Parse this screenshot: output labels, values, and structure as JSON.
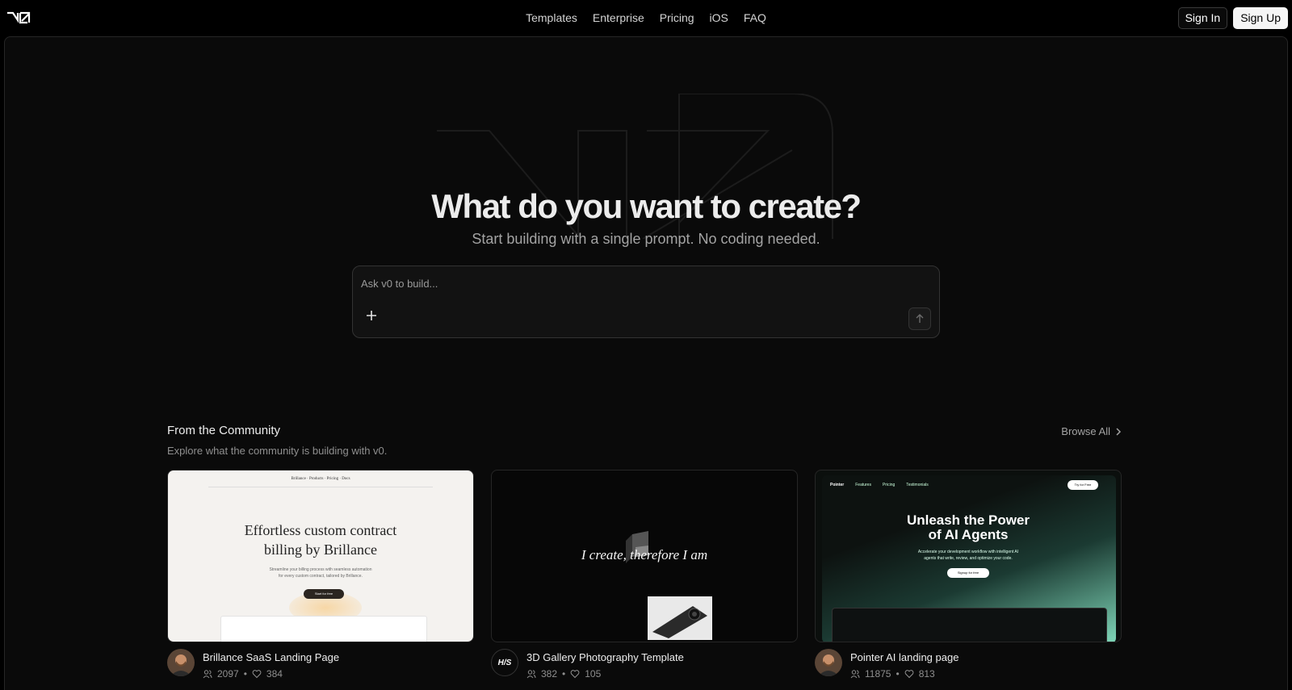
{
  "brand": {
    "logo_icon": "v0-logo-icon"
  },
  "nav": {
    "items": [
      "Templates",
      "Enterprise",
      "Pricing",
      "iOS",
      "FAQ"
    ]
  },
  "auth": {
    "sign_in": "Sign In",
    "sign_up": "Sign Up"
  },
  "hero": {
    "title": "What do you want to create?",
    "subtitle": "Start building with a single prompt. No coding needed."
  },
  "prompt": {
    "placeholder": "Ask v0 to build...",
    "value": "",
    "attach_icon": "plus-icon",
    "send_icon": "arrow-up-icon"
  },
  "community": {
    "title": "From the Community",
    "subtitle": "Explore what the community is building with v0.",
    "browse_all": "Browse All",
    "cards": [
      {
        "title": "Brillance SaaS Landing Page",
        "users": "2097",
        "likes": "384",
        "thumb": {
          "nav": "Brillance · Products · Pricing · Docs",
          "headline_1": "Effortless custom contract",
          "headline_2": "billing by Brillance",
          "body_1": "Streamline your billing process with seamless automation",
          "body_2": "for every custom contract, tailored by Brillance.",
          "cta": "Start for free"
        }
      },
      {
        "title": "3D Gallery Photography Template",
        "users": "382",
        "likes": "105",
        "avatar_text": "H/S",
        "thumb": {
          "headline": "I create, therefore I am"
        }
      },
      {
        "title": "Pointer AI landing page",
        "users": "11875",
        "likes": "813",
        "thumb": {
          "nav": [
            "Pointer",
            "Features",
            "Pricing",
            "Testimonials"
          ],
          "try": "Try for Free",
          "headline_1": "Unleash the Power",
          "headline_2": "of AI Agents",
          "body_1": "Accelerate your development workflow with intelligent AI",
          "body_2": "agents that write, review, and optimize your code.",
          "cta": "Signup for free"
        }
      }
    ]
  },
  "colors": {
    "background": "#000000",
    "panel": "#0a0a0a",
    "text": "#ededed",
    "muted": "#a3a3a3"
  }
}
